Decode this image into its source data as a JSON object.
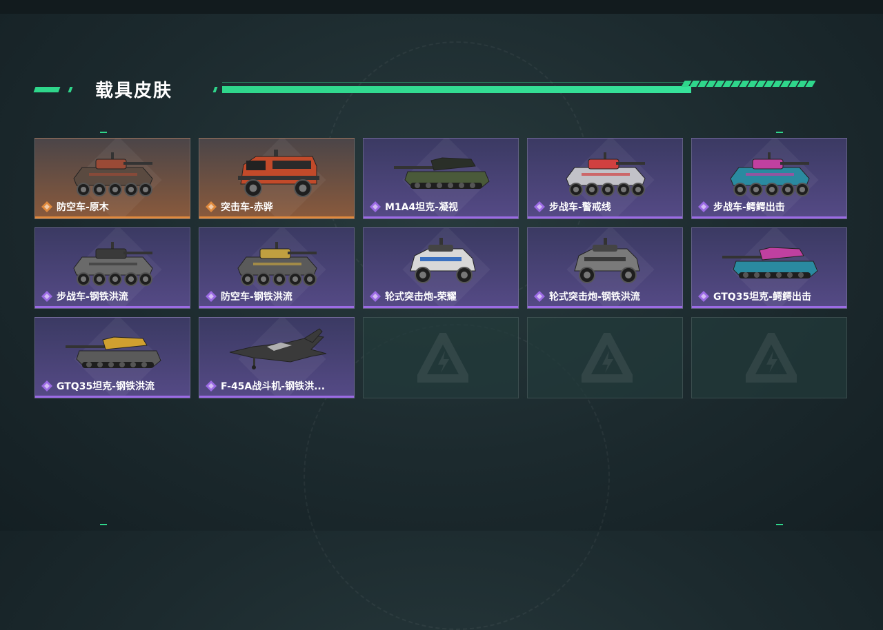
{
  "section": {
    "title": "载具皮肤"
  },
  "colors": {
    "accent_green": "#2fd68b",
    "rarity_purple": "#9c6be5",
    "rarity_orange": "#e08a3e"
  },
  "skins": [
    {
      "name": "防空车-原木",
      "rarity": "orange",
      "vehicle": "wheeled-aa-vehicle",
      "palette": [
        "#5a4a40",
        "#9a4a36"
      ]
    },
    {
      "name": "突击车-赤骅",
      "rarity": "orange",
      "vehicle": "assault-truck",
      "palette": [
        "#c24a2a",
        "#2a2a2a"
      ]
    },
    {
      "name": "M1A4坦克-凝视",
      "rarity": "purple",
      "vehicle": "tank",
      "palette": [
        "#4a5a3a",
        "#2a2f28"
      ]
    },
    {
      "name": "步战车-警戒线",
      "rarity": "purple",
      "vehicle": "ifv",
      "palette": [
        "#c2c2c8",
        "#d04040"
      ]
    },
    {
      "name": "步战车-鳄鳄出击",
      "rarity": "purple",
      "vehicle": "ifv",
      "palette": [
        "#2a8aa0",
        "#c040a0"
      ]
    },
    {
      "name": "步战车-钢铁洪流",
      "rarity": "purple",
      "vehicle": "ifv",
      "palette": [
        "#6a6a6a",
        "#3a3a3a"
      ]
    },
    {
      "name": "防空车-钢铁洪流",
      "rarity": "purple",
      "vehicle": "wheeled-aa-vehicle",
      "palette": [
        "#5a5a5a",
        "#c0a040"
      ]
    },
    {
      "name": "轮式突击炮-荣耀",
      "rarity": "purple",
      "vehicle": "armored-car",
      "palette": [
        "#d8d8d8",
        "#3a70c0"
      ]
    },
    {
      "name": "轮式突击炮-钢铁洪流",
      "rarity": "purple",
      "vehicle": "armored-car",
      "palette": [
        "#7a7a7a",
        "#3a3a3a"
      ]
    },
    {
      "name": "GTQ35坦克-鳄鳄出击",
      "rarity": "purple",
      "vehicle": "tank",
      "palette": [
        "#2a8aa0",
        "#c040a0"
      ]
    },
    {
      "name": "GTQ35坦克-钢铁洪流",
      "rarity": "purple",
      "vehicle": "tank",
      "palette": [
        "#5a5a5a",
        "#d0a030"
      ]
    },
    {
      "name": "F-45A战斗机-钢铁洪...",
      "rarity": "purple",
      "vehicle": "fighter-jet",
      "palette": [
        "#3a3a3a",
        "#b0b0b0"
      ]
    },
    {
      "name": "",
      "rarity": "empty",
      "vehicle": ""
    },
    {
      "name": "",
      "rarity": "empty",
      "vehicle": ""
    },
    {
      "name": "",
      "rarity": "empty",
      "vehicle": ""
    }
  ]
}
